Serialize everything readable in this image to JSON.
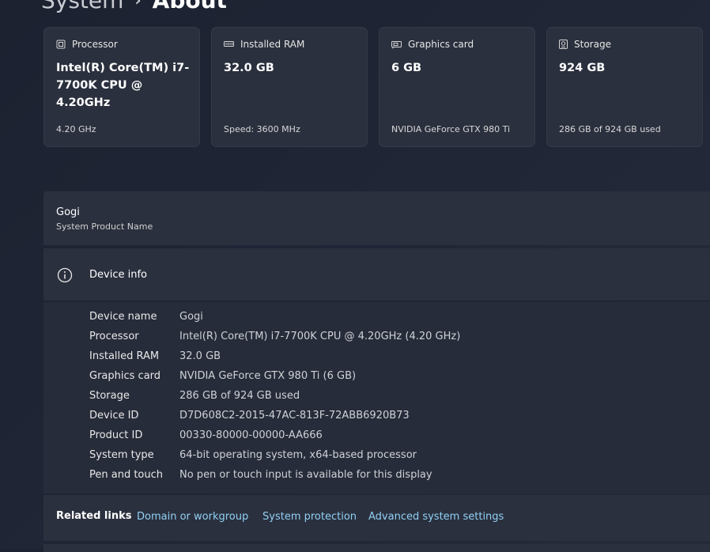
{
  "header": {
    "parent": "System",
    "separator": "›",
    "title": "About"
  },
  "cards": [
    {
      "icon": "processor-icon",
      "label": "Processor",
      "value": "Intel(R) Core(TM) i7-7700K CPU @ 4.20GHz",
      "sub": "4.20 GHz"
    },
    {
      "icon": "ram-icon",
      "label": "Installed RAM",
      "value": "32.0 GB",
      "sub": "Speed: 3600 MHz"
    },
    {
      "icon": "graphics-card-icon",
      "label": "Graphics card",
      "value": "6 GB",
      "sub": "NVIDIA GeForce GTX 980 Ti"
    },
    {
      "icon": "storage-icon",
      "label": "Storage",
      "value": "924 GB",
      "sub": "286 GB of 924 GB used"
    }
  ],
  "product": {
    "name": "Gogi",
    "sub": "System Product Name"
  },
  "device_info": {
    "icon": "info-icon",
    "title": "Device info",
    "rows": [
      {
        "label": "Device name",
        "value": "Gogi"
      },
      {
        "label": "Processor",
        "value": "Intel(R) Core(TM) i7-7700K CPU @ 4.20GHz (4.20 GHz)"
      },
      {
        "label": "Installed RAM",
        "value": "32.0 GB"
      },
      {
        "label": "Graphics card",
        "value": "NVIDIA GeForce GTX 980 Ti (6 GB)"
      },
      {
        "label": "Storage",
        "value": "286 GB of 924 GB used"
      },
      {
        "label": "Device ID",
        "value": "D7D608C2-2015-47AC-813F-72ABB6920B73"
      },
      {
        "label": "Product ID",
        "value": "00330-80000-00000-AA666"
      },
      {
        "label": "System type",
        "value": "64-bit operating system, x64-based processor"
      },
      {
        "label": "Pen and touch",
        "value": "No pen or touch input is available for this display"
      }
    ]
  },
  "related_links": {
    "label": "Related links",
    "links": [
      "Domain or workgroup",
      "System protection",
      "Advanced system settings"
    ]
  },
  "colors": {
    "background": "#1f2535",
    "card": "#2b303e",
    "link": "#8fd0f4"
  }
}
